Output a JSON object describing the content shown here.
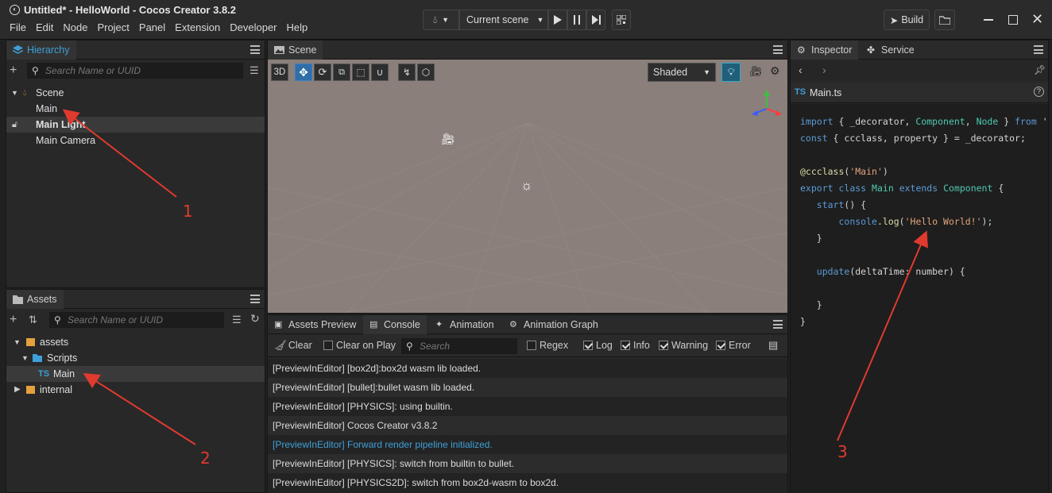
{
  "window": {
    "title": "Untitled* - HelloWorld - Cocos Creator 3.8.2",
    "build_label": "Build"
  },
  "menu": [
    "File",
    "Edit",
    "Node",
    "Project",
    "Panel",
    "Extension",
    "Developer",
    "Help"
  ],
  "toolbar": {
    "scene_select": "Current scene"
  },
  "hierarchy": {
    "tab": "Hierarchy",
    "search_placeholder": "Search Name or UUID",
    "nodes": [
      "Scene",
      "Main",
      "Main Light",
      "Main Camera"
    ]
  },
  "assets": {
    "tab": "Assets",
    "search_placeholder": "Search Name or UUID",
    "items": [
      "assets",
      "Scripts",
      "Main",
      "internal"
    ],
    "ts_badge": "TS"
  },
  "scene": {
    "tab": "Scene",
    "mode_3d": "3D",
    "shading": "Shaded"
  },
  "bottom_tabs": [
    "Assets Preview",
    "Console",
    "Animation",
    "Animation Graph"
  ],
  "console": {
    "clear": "Clear",
    "clear_on_play": "Clear on Play",
    "search_placeholder": "Search",
    "filters": {
      "regex": "Regex",
      "log": "Log",
      "info": "Info",
      "warning": "Warning",
      "error": "Error"
    },
    "lines": [
      "[PreviewInEditor] [box2d]:box2d wasm lib loaded.",
      "[PreviewInEditor] [bullet]:bullet wasm lib loaded.",
      "[PreviewInEditor] [PHYSICS]: using builtin.",
      "[PreviewInEditor] Cocos Creator v3.8.2",
      "[PreviewInEditor] Forward render pipeline initialized.",
      "[PreviewInEditor] [PHYSICS]: switch from builtin to bullet.",
      "[PreviewInEditor] [PHYSICS2D]: switch from box2d-wasm to box2d."
    ]
  },
  "inspector": {
    "tab": "Inspector",
    "service_tab": "Service",
    "file": "Main.ts",
    "ts_badge": "TS"
  },
  "annotations": [
    "1",
    "2",
    "3"
  ],
  "colors": {
    "accent": "#3fa0d9",
    "arrow": "#e03a2f",
    "viewport": "#8a7f7a"
  }
}
